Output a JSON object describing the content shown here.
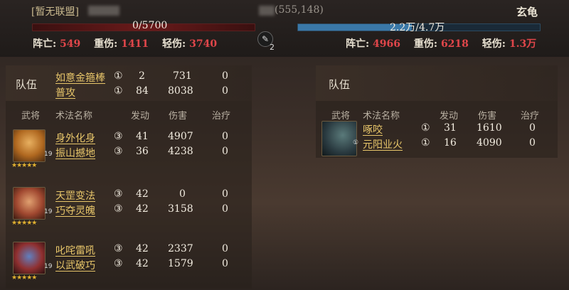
{
  "header": {
    "alliance": "[暂无联盟]",
    "coords": "(555,148)",
    "enemy_name": "玄龟",
    "left_troops": "0/5700",
    "right_troops": "2.2万/4.7万",
    "right_troops_fraction": 0.47,
    "center_count": "2"
  },
  "left_stats": {
    "dead_label": "阵亡:",
    "dead": "549",
    "heavy_label": "重伤:",
    "heavy": "1411",
    "light_label": "轻伤:",
    "light": "3740"
  },
  "right_stats": {
    "dead_label": "阵亡:",
    "dead": "4966",
    "heavy_label": "重伤:",
    "heavy": "6218",
    "light_label": "轻伤:",
    "light": "1.3万"
  },
  "columns": {
    "general": "武将",
    "skill": "术法名称",
    "triggers": "发动",
    "damage": "伤害",
    "heal": "治疗"
  },
  "left_team": {
    "label": "队伍",
    "skills": [
      {
        "name": "如意金箍棒",
        "level": "①",
        "triggers": "2",
        "damage": "731",
        "heal": "0"
      },
      {
        "name": "普攻",
        "level": "①",
        "triggers": "84",
        "damage": "8038",
        "heal": "0"
      }
    ],
    "heroes": [
      {
        "level": "19",
        "stars": "★★★★★",
        "skills": [
          {
            "name": "身外化身",
            "level": "③",
            "triggers": "41",
            "damage": "4907",
            "heal": "0"
          },
          {
            "name": "振山撼地",
            "level": "③",
            "triggers": "36",
            "damage": "4238",
            "heal": "0"
          }
        ]
      },
      {
        "level": "19",
        "stars": "★★★★★",
        "skills": [
          {
            "name": "天罡变法",
            "level": "③",
            "triggers": "42",
            "damage": "0",
            "heal": "0"
          },
          {
            "name": "巧夺灵魄",
            "level": "③",
            "triggers": "42",
            "damage": "3158",
            "heal": "0"
          }
        ]
      },
      {
        "level": "19",
        "stars": "★★★★★",
        "skills": [
          {
            "name": "叱咤雷吼",
            "level": "③",
            "triggers": "42",
            "damage": "2337",
            "heal": "0"
          },
          {
            "name": "以武破巧",
            "level": "③",
            "triggers": "42",
            "damage": "1579",
            "heal": "0"
          }
        ]
      }
    ]
  },
  "right_team": {
    "label": "队伍",
    "hero": {
      "level": "①",
      "skills": [
        {
          "name": "啄咬",
          "level": "①",
          "triggers": "31",
          "damage": "1610",
          "heal": "0"
        },
        {
          "name": "元阳业火",
          "level": "①",
          "triggers": "16",
          "damage": "4090",
          "heal": "0"
        }
      ]
    }
  }
}
